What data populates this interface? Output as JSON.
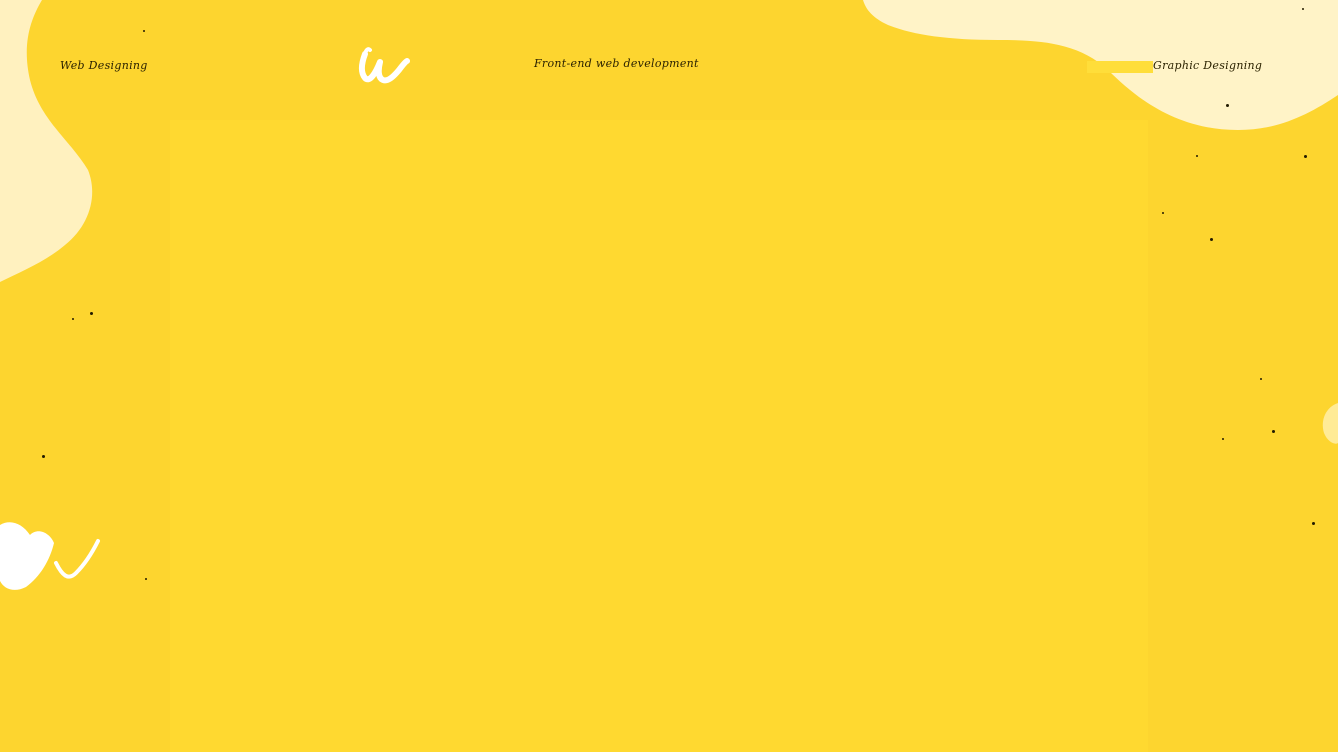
{
  "nav": {
    "left_label": "Web Designing",
    "center_label": "Front-end web development",
    "right_label": "Graphic Designing"
  },
  "logo": {
    "icon": "brush-u-logo-icon"
  },
  "colors": {
    "background": "#fdd52f",
    "panel": "#ffd930",
    "paint": "#fffbe9",
    "text": "#2b2200"
  }
}
